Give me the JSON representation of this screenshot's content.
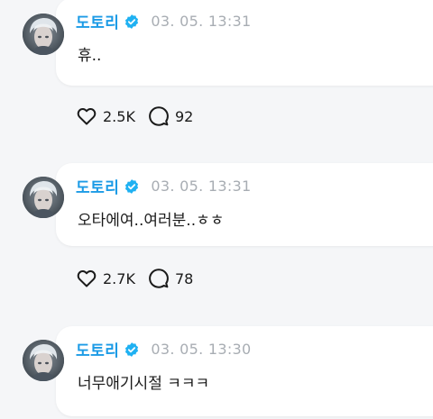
{
  "posts": [
    {
      "author": "도토리",
      "timestamp": "03. 05. 13:31",
      "text": "휴..",
      "likes": "2.5K",
      "comments": "92"
    },
    {
      "author": "도토리",
      "timestamp": "03. 05. 13:31",
      "text": "오타에여..여러분..ㅎㅎ",
      "likes": "2.7K",
      "comments": "78"
    },
    {
      "author": "도토리",
      "timestamp": "03. 05. 13:30",
      "text": "너무애기시절 ㅋㅋㅋ"
    }
  ],
  "icons": {
    "verified": "verified-badge-icon",
    "like": "heart-icon",
    "comment": "comment-bubble-icon"
  },
  "colors": {
    "author": "#1c9be6",
    "verified": "#1fb1f2",
    "timestamp": "#a8adb3",
    "background": "#f5f6f8",
    "bubble": "#ffffff"
  }
}
